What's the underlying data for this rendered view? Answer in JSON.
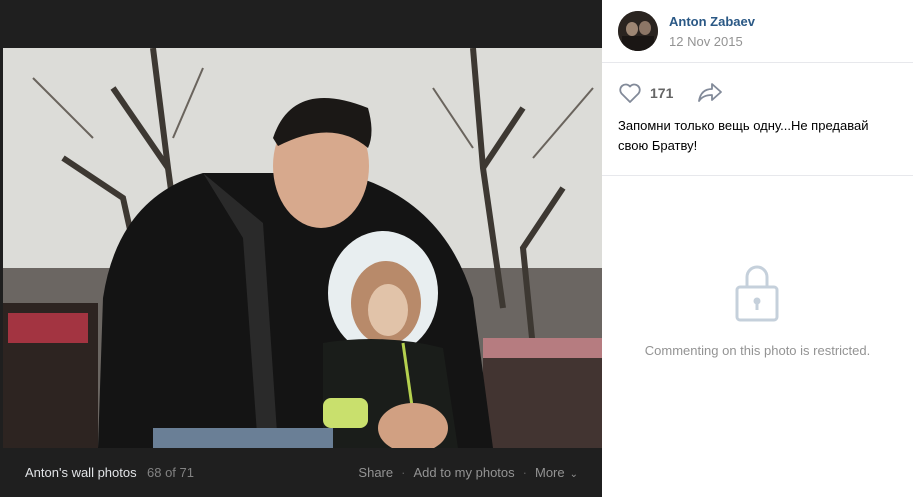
{
  "footer": {
    "album_title": "Anton's wall photos",
    "counter": "68 of 71",
    "share_label": "Share",
    "separator": "·",
    "add_label": "Add to my photos",
    "more_label": "More",
    "more_chevron": "⌄"
  },
  "post": {
    "author": "Anton Zabaev",
    "date": "12 Nov 2015",
    "likes": "171",
    "caption": "Запомни только вещь одну...Не предавай свою Братву!"
  },
  "comments": {
    "restricted_text": "Commenting on this photo is restricted."
  },
  "icons": {
    "like": "heart-icon",
    "share": "share-arrow-icon",
    "lock": "lock-icon",
    "more": "chevron-down-icon"
  },
  "colors": {
    "viewer_bg": "#1f1f1f",
    "link": "#2a5885",
    "muted": "#939393"
  }
}
